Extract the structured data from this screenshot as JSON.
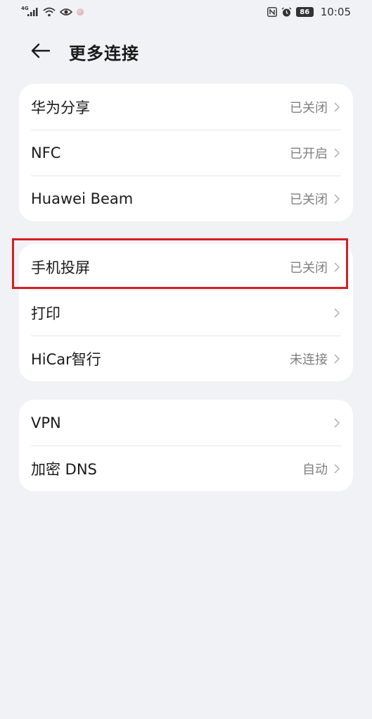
{
  "status_bar": {
    "network": "4G",
    "battery": "86",
    "time": "10:05"
  },
  "header": {
    "title": "更多连接"
  },
  "groups": [
    {
      "items": [
        {
          "label": "华为分享",
          "value": "已关闭"
        },
        {
          "label": "NFC",
          "value": "已开启"
        },
        {
          "label": "Huawei Beam",
          "value": "已关闭"
        }
      ]
    },
    {
      "items": [
        {
          "label": "手机投屏",
          "value": "已关闭"
        },
        {
          "label": "打印",
          "value": ""
        },
        {
          "label": "HiCar智行",
          "value": "未连接"
        }
      ]
    },
    {
      "items": [
        {
          "label": "VPN",
          "value": ""
        },
        {
          "label": "加密 DNS",
          "value": "自动"
        }
      ]
    }
  ],
  "highlight_color": "#d61e22"
}
